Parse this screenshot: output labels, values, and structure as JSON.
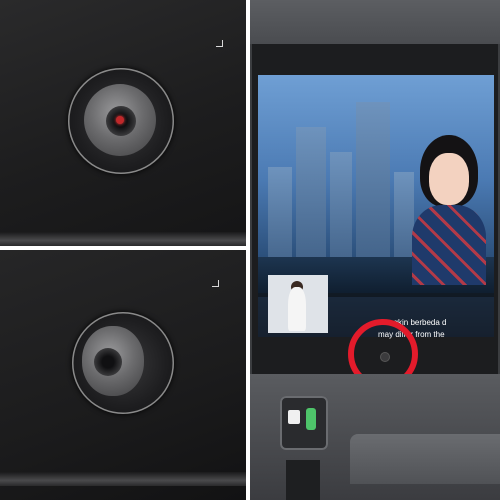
{
  "panels": {
    "top_left": {
      "subject": "camera-lens-with-red-dot"
    },
    "bottom_left": {
      "subject": "camera-lens-closeup"
    },
    "right": {
      "subject": "seatback-entertainment-screen",
      "subtitle_line1": "mungkin berbeda d",
      "subtitle_line2": "may differ from the",
      "highlight_color": "#e31b2b"
    }
  }
}
